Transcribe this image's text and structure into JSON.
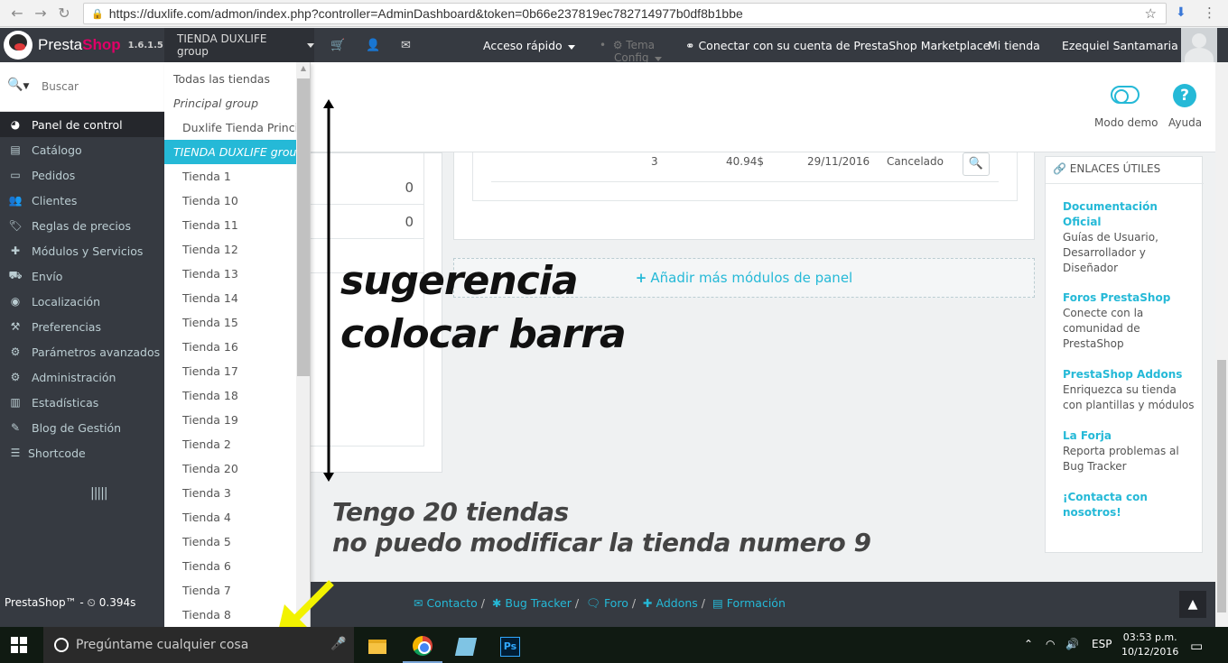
{
  "browser": {
    "url": "https://duxlife.com/admon/index.php?controller=AdminDashboard&token=0b66e237819ec782714977b0df8b1bbe"
  },
  "header": {
    "logo_brand_a": "Presta",
    "logo_brand_b": "Shop",
    "version": "1.6.1.5",
    "shop_selector": "TIENDA DUXLIFE group",
    "quick_access": "Acceso rápido",
    "theme": "Tema",
    "config": "Config",
    "marketplace": "Conectar con su cuenta de PrestaShop Marketplace",
    "my_store": "Mi tienda",
    "user": "Ezequiel Santamaria"
  },
  "sidebar": {
    "search_placeholder": "Buscar",
    "items": [
      {
        "label": "Panel de control",
        "icon": "dashboard-icon"
      },
      {
        "label": "Catálogo",
        "icon": "catalog-icon"
      },
      {
        "label": "Pedidos",
        "icon": "orders-icon"
      },
      {
        "label": "Clientes",
        "icon": "customers-icon"
      },
      {
        "label": "Reglas de precios",
        "icon": "tag-icon"
      },
      {
        "label": "Módulos y Servicios",
        "icon": "puzzle-icon"
      },
      {
        "label": "Envío",
        "icon": "truck-icon"
      },
      {
        "label": "Localización",
        "icon": "globe-icon"
      },
      {
        "label": "Preferencias",
        "icon": "wrench-icon"
      },
      {
        "label": "Parámetros avanzados",
        "icon": "gears-icon"
      },
      {
        "label": "Administración",
        "icon": "gear-icon"
      },
      {
        "label": "Estadísticas",
        "icon": "bar-chart-icon"
      },
      {
        "label": "Blog de Gestión",
        "icon": "pencil-icon"
      },
      {
        "label": "Shortcode",
        "icon": "list-icon"
      }
    ],
    "footer": "PrestaShop™ -",
    "load_time": "0.394s"
  },
  "dropdown": {
    "all_stores": "Todas las tiendas",
    "group1": "Principal group",
    "group1_shop": "Duxlife Tienda Principal",
    "group2": "TIENDA DUXLIFE group",
    "shops": [
      "Tienda 1",
      "Tienda 10",
      "Tienda 11",
      "Tienda 12",
      "Tienda 13",
      "Tienda 14",
      "Tienda 15",
      "Tienda 16",
      "Tienda 17",
      "Tienda 18",
      "Tienda 19",
      "Tienda 2",
      "Tienda 20",
      "Tienda 3",
      "Tienda 4",
      "Tienda 5",
      "Tienda 6",
      "Tienda 7",
      "Tienda 8"
    ]
  },
  "toolbar": {
    "demo_mode": "Modo demo",
    "help": "Ayuda"
  },
  "left_panel": {
    "values": [
      "0",
      "0"
    ]
  },
  "orders": {
    "qty": "3",
    "total": "40.94$",
    "date": "29/11/2016",
    "status": "Cancelado"
  },
  "add_modules": "Añadir más módulos de panel",
  "useful_links": {
    "title": "ENLACES ÚTILES",
    "items": [
      {
        "title": "Documentación Oficial",
        "desc": "Guías de Usuario, Desarrollador y Diseñador"
      },
      {
        "title": "Foros PrestaShop",
        "desc": "Conecte con la comunidad de PrestaShop"
      },
      {
        "title": "PrestaShop Addons",
        "desc": "Enriquezca su tienda con plantillas y módulos"
      },
      {
        "title": "La Forja",
        "desc": "Reporta problemas al Bug Tracker"
      },
      {
        "title": "¡Contacta con nosotros!",
        "desc": ""
      }
    ]
  },
  "annotations": {
    "line1": "sugerencia",
    "line2": "colocar barra",
    "line3": "Tengo 20 tiendas",
    "line4": "no puedo modificar la tienda numero 9"
  },
  "footer": {
    "links": [
      "Contacto",
      "Bug Tracker",
      "Foro",
      "Addons",
      "Formación"
    ]
  },
  "taskbar": {
    "search": "Pregúntame cualquier cosa",
    "lang": "ESP",
    "time": "03:53 p.m.",
    "date": "10/12/2016"
  },
  "colors": {
    "accent": "#25b9d7",
    "sidebar": "#363a41",
    "brand": "#df0067",
    "selected_purple": "#8a4fbf",
    "annotation_yellow": "#f2f200"
  }
}
